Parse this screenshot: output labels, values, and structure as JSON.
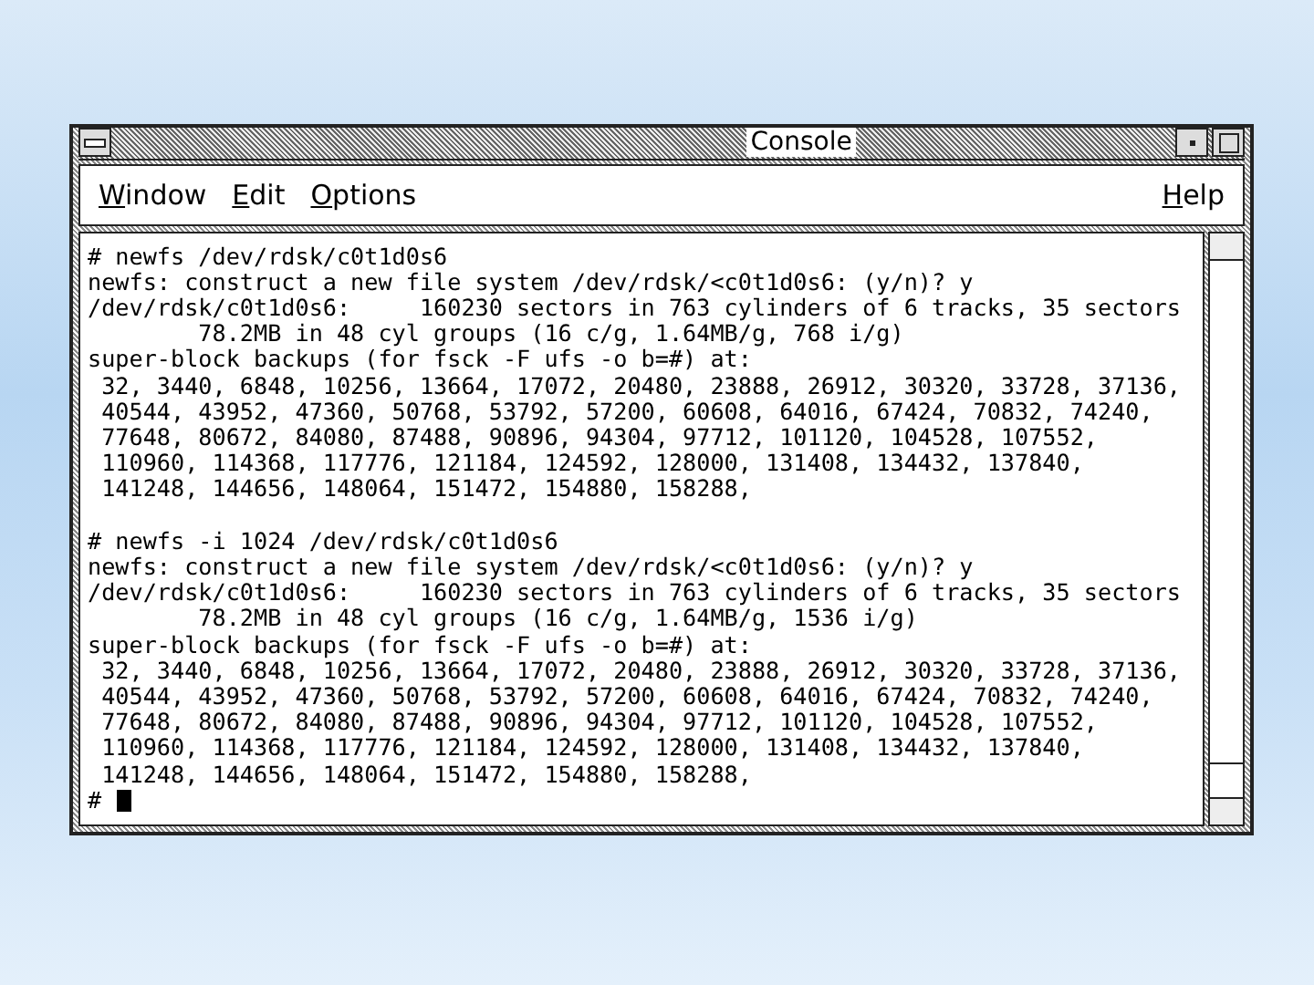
{
  "window": {
    "title": "Console"
  },
  "menu": {
    "left": [
      {
        "label": "Window"
      },
      {
        "label": "Edit"
      },
      {
        "label": "Options"
      }
    ],
    "right": [
      {
        "label": "Help"
      }
    ]
  },
  "terminal": {
    "blocks": [
      [
        "# newfs /dev/rdsk/c0t1d0s6",
        "newfs: construct a new file system /dev/rdsk/<c0t1d0s6: (y/n)? y",
        "/dev/rdsk/c0t1d0s6:     160230 sectors in 763 cylinders of 6 tracks, 35 sectors",
        "        78.2MB in 48 cyl groups (16 c/g, 1.64MB/g, 768 i/g)",
        "super-block backups (for fsck -F ufs -o b=#) at:",
        " 32, 3440, 6848, 10256, 13664, 17072, 20480, 23888, 26912, 30320, 33728, 37136,",
        " 40544, 43952, 47360, 50768, 53792, 57200, 60608, 64016, 67424, 70832, 74240,",
        " 77648, 80672, 84080, 87488, 90896, 94304, 97712, 101120, 104528, 107552,",
        " 110960, 114368, 117776, 121184, 124592, 128000, 131408, 134432, 137840,",
        " 141248, 144656, 148064, 151472, 154880, 158288,"
      ],
      [
        "# newfs -i 1024 /dev/rdsk/c0t1d0s6",
        "newfs: construct a new file system /dev/rdsk/<c0t1d0s6: (y/n)? y",
        "/dev/rdsk/c0t1d0s6:     160230 sectors in 763 cylinders of 6 tracks, 35 sectors",
        "        78.2MB in 48 cyl groups (16 c/g, 1.64MB/g, 1536 i/g)",
        "super-block backups (for fsck -F ufs -o b=#) at:",
        " 32, 3440, 6848, 10256, 13664, 17072, 20480, 23888, 26912, 30320, 33728, 37136,",
        " 40544, 43952, 47360, 50768, 53792, 57200, 60608, 64016, 67424, 70832, 74240,",
        " 77648, 80672, 84080, 87488, 90896, 94304, 97712, 101120, 104528, 107552,",
        " 110960, 114368, 117776, 121184, 124592, 128000, 131408, 134432, 137840,",
        " 141248, 144656, 148064, 151472, 154880, 158288,"
      ]
    ],
    "prompt": "#"
  }
}
